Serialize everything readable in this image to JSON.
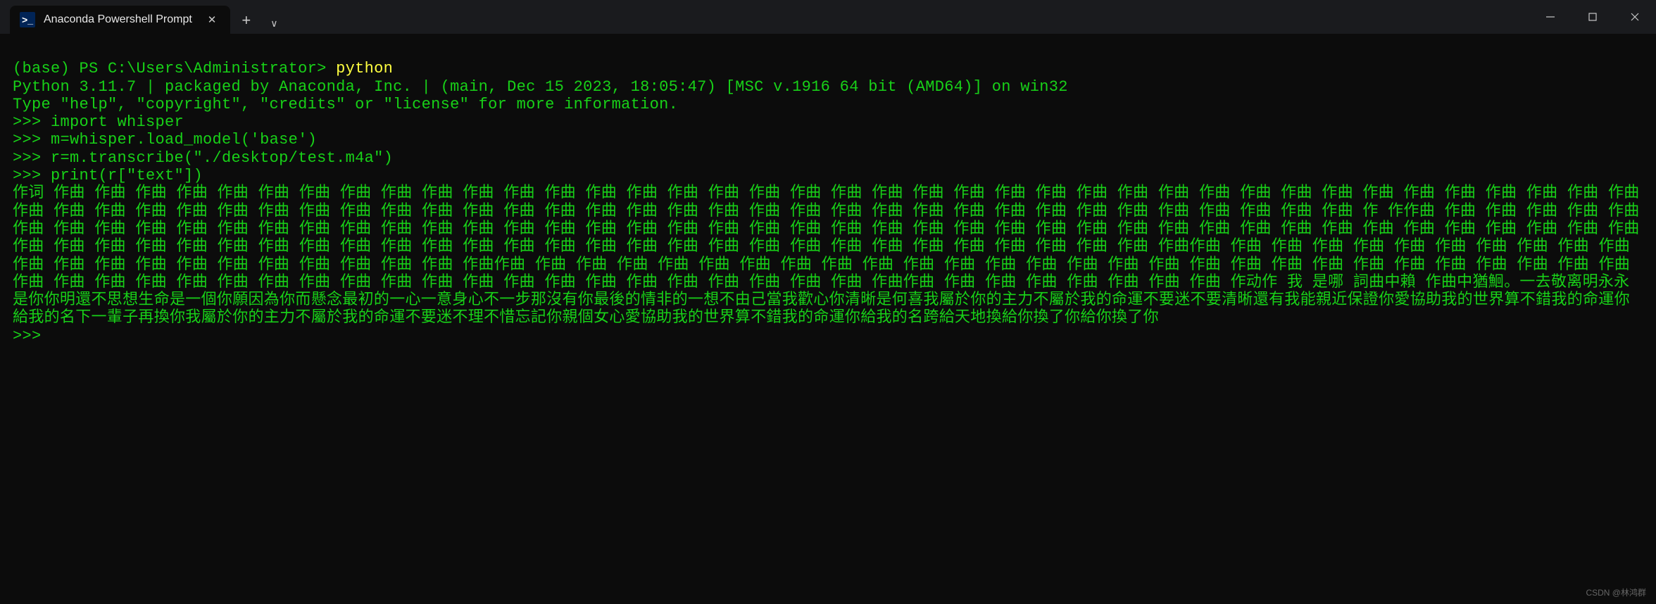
{
  "window": {
    "tab_title": "Anaconda Powershell Prompt",
    "new_tab_label": "+",
    "dropdown_label": "∨",
    "close_tab_label": "✕"
  },
  "terminal": {
    "prompt1_env": "(base) ",
    "prompt1_path": "PS C:\\Users\\Administrator> ",
    "cmd1": "python",
    "header_line1": "Python 3.11.7 | packaged by Anaconda, Inc. | (main, Dec 15 2023, 18:05:47) [MSC v.1916 64 bit (AMD64)] on win32",
    "header_line2": "Type \"help\", \"copyright\", \"credits\" or \"license\" for more information.",
    "repl_prompt": ">>> ",
    "cmd2": "import whisper",
    "cmd3": "m=whisper.load_model('base')",
    "cmd4": "r=m.transcribe(\"./desktop/test.m4a\")",
    "cmd5": "print(r[\"text\"])",
    "output_block": "作词 作曲 作曲 作曲 作曲 作曲 作曲 作曲 作曲 作曲 作曲 作曲 作曲 作曲 作曲 作曲 作曲 作曲 作曲 作曲 作曲 作曲 作曲 作曲 作曲 作曲 作曲 作曲 作曲 作曲 作曲 作曲 作曲 作曲 作曲 作曲 作曲 作曲 作曲 作曲 作曲 作曲 作曲 作曲 作曲 作曲 作曲 作曲 作曲 作曲 作曲 作曲 作曲 作曲 作曲 作曲 作曲 作曲 作曲 作曲 作曲 作曲 作曲 作曲 作曲 作曲 作曲 作曲 作曲 作曲 作曲 作曲 作曲 作 作作曲 作曲 作曲 作曲 作曲 作曲 作曲 作曲 作曲 作曲 作曲 作曲 作曲 作曲 作曲 作曲 作曲 作曲 作曲 作曲 作曲 作曲 作曲 作曲 作曲 作曲 作曲 作曲 作曲 作曲 作曲 作曲 作曲 作曲 作曲 作曲 作曲 作曲 作曲 作曲 作曲 作曲 作曲 作曲 作曲 作曲 作曲 作曲 作曲 作曲 作曲 作曲 作曲 作曲 作曲 作曲 作曲 作曲 作曲 作曲 作曲 作曲 作曲 作曲 作曲 作曲 作曲 作曲 作曲 作曲 作曲 作曲 作曲 作曲 作曲作曲 作曲 作曲 作曲 作曲 作曲 作曲 作曲 作曲 作曲 作曲 作曲 作曲 作曲 作曲 作曲 作曲 作曲 作曲 作曲 作曲 作曲 作曲作曲 作曲 作曲 作曲 作曲 作曲 作曲 作曲 作曲 作曲 作曲 作曲 作曲 作曲 作曲 作曲 作曲 作曲 作曲 作曲 作曲 作曲 作曲 作曲 作曲 作曲 作曲 作曲 作曲 作曲 作曲 作曲 作曲 作曲 作曲 作曲 作曲 作曲 作曲 作曲 作曲 作曲 作曲 作曲 作曲 作曲 作曲 作曲 作曲 作曲作曲 作曲 作曲 作曲 作曲 作曲 作曲 作曲 作动作 我 是哪 詞曲中賴 作曲中猶鮰。一去敬离明永永是你你明還不思想生命是一個你願因為你而懸念最初的一心一意身心不一步那沒有你最後的情非的一想不由己當我歡心你清晰是何喜我屬於你的主力不屬於我的命運不要迷不要清晰還有我能親近保證你愛協助我的世界算不錯我的命運你給我的名下一輩子再換你我屬於你的主力不屬於我的命運不要迷不理不惜忘記你親個女心愛協助我的世界算不錯我的命運你給我的名跨給天地換給你換了你給你換了你",
    "final_prompt": ">>> "
  },
  "watermark": "CSDN @林鸿群"
}
